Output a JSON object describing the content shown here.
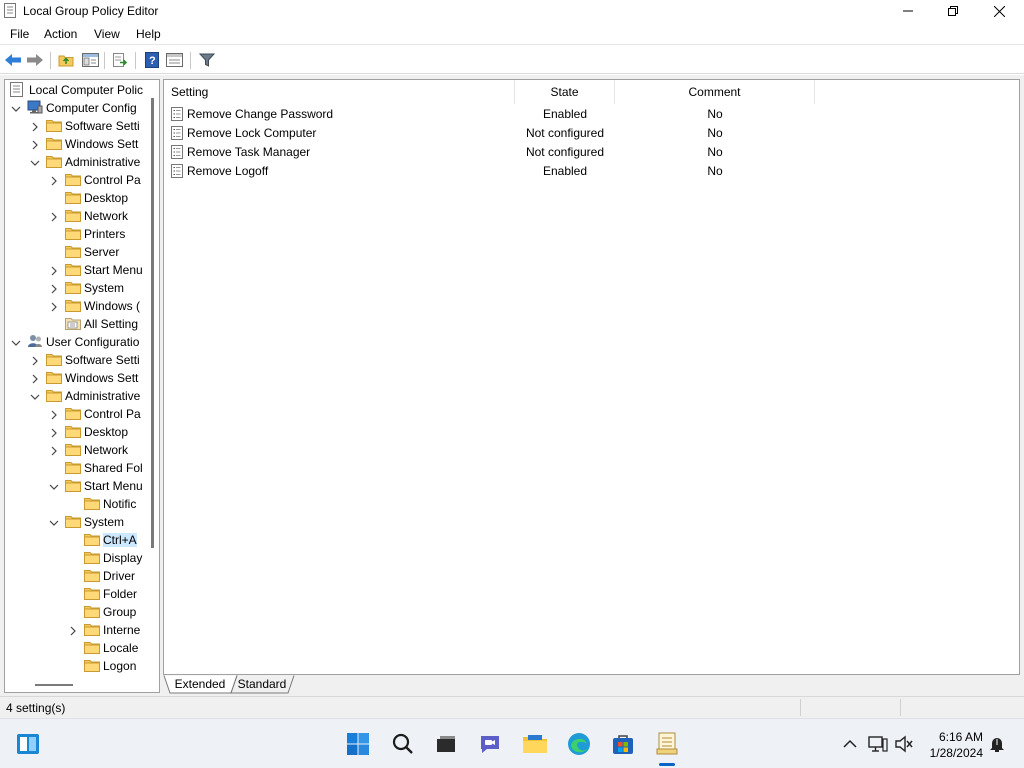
{
  "window": {
    "title": "Local Group Policy Editor"
  },
  "menu": {
    "file": "File",
    "action": "Action",
    "view": "View",
    "help": "Help"
  },
  "tree": [
    {
      "label": "Local Computer Polic",
      "level": 0,
      "expander": "none",
      "icon": "policy",
      "name": "tree-root"
    },
    {
      "label": "Computer Config",
      "level": 1,
      "expander": "open",
      "icon": "computer",
      "name": "tree-computer-configuration"
    },
    {
      "label": "Software Setti",
      "level": 2,
      "expander": "closed",
      "icon": "folder",
      "name": "tree-software-settings"
    },
    {
      "label": "Windows Sett",
      "level": 2,
      "expander": "closed",
      "icon": "folder",
      "name": "tree-windows-settings"
    },
    {
      "label": "Administrative",
      "level": 2,
      "expander": "open",
      "icon": "folder",
      "name": "tree-administrative-templates"
    },
    {
      "label": "Control Pa",
      "level": 3,
      "expander": "closed",
      "icon": "folder",
      "name": "tree-control-panel"
    },
    {
      "label": "Desktop",
      "level": 3,
      "expander": "none",
      "icon": "folder",
      "name": "tree-desktop"
    },
    {
      "label": "Network",
      "level": 3,
      "expander": "closed",
      "icon": "folder",
      "name": "tree-network"
    },
    {
      "label": "Printers",
      "level": 3,
      "expander": "none",
      "icon": "folder",
      "name": "tree-printers"
    },
    {
      "label": "Server",
      "level": 3,
      "expander": "none",
      "icon": "folder",
      "name": "tree-server"
    },
    {
      "label": "Start Menu",
      "level": 3,
      "expander": "closed",
      "icon": "folder",
      "name": "tree-start-menu"
    },
    {
      "label": "System",
      "level": 3,
      "expander": "closed",
      "icon": "folder",
      "name": "tree-system"
    },
    {
      "label": "Windows (",
      "level": 3,
      "expander": "closed",
      "icon": "folder",
      "name": "tree-windows-components"
    },
    {
      "label": "All Setting",
      "level": 3,
      "expander": "none",
      "icon": "allsettings",
      "name": "tree-all-settings"
    },
    {
      "label": "User Configuratio",
      "level": 1,
      "expander": "open",
      "icon": "user",
      "name": "tree-user-configuration"
    },
    {
      "label": "Software Setti",
      "level": 2,
      "expander": "closed",
      "icon": "folder",
      "name": "tree-user-software-settings"
    },
    {
      "label": "Windows Sett",
      "level": 2,
      "expander": "closed",
      "icon": "folder",
      "name": "tree-user-windows-settings"
    },
    {
      "label": "Administrative",
      "level": 2,
      "expander": "open",
      "icon": "folder",
      "name": "tree-user-administrative-templates"
    },
    {
      "label": "Control Pa",
      "level": 3,
      "expander": "closed",
      "icon": "folder",
      "name": "tree-user-control-panel"
    },
    {
      "label": "Desktop",
      "level": 3,
      "expander": "closed",
      "icon": "folder",
      "name": "tree-user-desktop"
    },
    {
      "label": "Network",
      "level": 3,
      "expander": "closed",
      "icon": "folder",
      "name": "tree-user-network"
    },
    {
      "label": "Shared Fol",
      "level": 3,
      "expander": "none",
      "icon": "folder",
      "name": "tree-user-shared-folders"
    },
    {
      "label": "Start Menu",
      "level": 3,
      "expander": "open",
      "icon": "folder",
      "name": "tree-user-start-menu"
    },
    {
      "label": "Notific",
      "level": 4,
      "expander": "none",
      "icon": "folder",
      "name": "tree-user-notifications"
    },
    {
      "label": "System",
      "level": 3,
      "expander": "open",
      "icon": "folder",
      "name": "tree-user-system"
    },
    {
      "label": "Ctrl+A",
      "level": 4,
      "expander": "none",
      "icon": "folder",
      "name": "tree-user-ctrl-alt-del",
      "selected": true
    },
    {
      "label": "Display",
      "level": 4,
      "expander": "none",
      "icon": "folder",
      "name": "tree-user-display"
    },
    {
      "label": "Driver",
      "level": 4,
      "expander": "none",
      "icon": "folder",
      "name": "tree-user-driver"
    },
    {
      "label": "Folder",
      "level": 4,
      "expander": "none",
      "icon": "folder",
      "name": "tree-user-folder"
    },
    {
      "label": "Group",
      "level": 4,
      "expander": "none",
      "icon": "folder",
      "name": "tree-user-group"
    },
    {
      "label": "Interne",
      "level": 4,
      "expander": "closed",
      "icon": "folder",
      "name": "tree-user-internet"
    },
    {
      "label": "Locale",
      "level": 4,
      "expander": "none",
      "icon": "folder",
      "name": "tree-user-locale"
    },
    {
      "label": "Logon",
      "level": 4,
      "expander": "none",
      "icon": "folder",
      "name": "tree-user-logon"
    }
  ],
  "details": {
    "columns": {
      "setting": "Setting",
      "state": "State",
      "comment": "Comment"
    },
    "rows": [
      {
        "setting": "Remove Change Password",
        "state": "Enabled",
        "comment": "No"
      },
      {
        "setting": "Remove Lock Computer",
        "state": "Not configured",
        "comment": "No"
      },
      {
        "setting": "Remove Task Manager",
        "state": "Not configured",
        "comment": "No"
      },
      {
        "setting": "Remove Logoff",
        "state": "Enabled",
        "comment": "No"
      }
    ]
  },
  "tabs": {
    "extended": "Extended",
    "standard": "Standard"
  },
  "status": {
    "text": "4 setting(s)"
  },
  "taskbar": {
    "time": "6:16 AM",
    "date": "1/28/2024"
  },
  "colors": {
    "selection": "#cce8ff",
    "folder": "#f4c95d",
    "accent": "#0a64c8"
  }
}
